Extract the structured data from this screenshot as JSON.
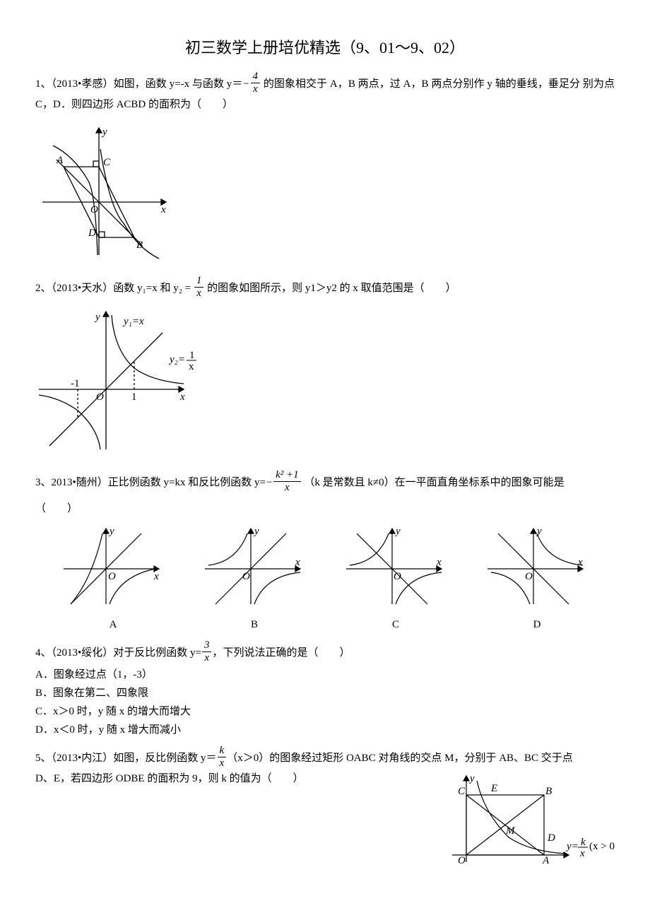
{
  "title": "初三数学上册培优精选（9、01～9、02）",
  "q1": {
    "pre": "1、（2013•孝感）如图，函数 y=-x 与函数 y＝",
    "frac_num": "4",
    "frac_den": "x",
    "neg": "−",
    "post1": " 的图象相交于 A，B 两点，过 A，B 两点分别作 y 轴的垂线，垂足分",
    "post2": "别为点 C，D．则四边形 ACBD 的面积为（　　）"
  },
  "q2": {
    "pre": "2、（2013•天水）函数 y₁=x 和 y₂ = ",
    "frac_num": "1",
    "frac_den": "x",
    "post": " 的图象如图所示，则 y1＞y2 的 x 取值范围是（　　）",
    "fig_label_y1": "y₁=x",
    "fig_label_y2": "y₂= 1/x",
    "neg1": "-1",
    "one": "1"
  },
  "q3": {
    "pre": "3、2013•随州）正比例函数 y=kx 和反比例函数 y=",
    "neg": "−",
    "frac_num": "k² +1",
    "frac_den": "x",
    "post1": " （k 是常数且 k≠0）在一平面直角坐标系中的图象可能是",
    "post2": "（　　）",
    "optA": "A",
    "optB": "B",
    "optC": "C",
    "optD": "D"
  },
  "q4": {
    "pre": "4、（2013•绥化）对于反比例函数 y=",
    "frac_num": "3",
    "frac_den": "x",
    "post": "，下列说法正确的是（　　）",
    "A": "A．图象经过点（1，-3）",
    "B": "B．图象在第二、四象限",
    "C": "C．x＞0 时，y 随 x 的增大而增大",
    "D": "D．x＜0 时，y 随 x 增大而减小"
  },
  "q5": {
    "pre": "5、（2013•内江）如图，反比例函数 y＝",
    "frac_num": "k",
    "frac_den": "x",
    "post1": "（x＞0）的图象经过矩形 OABC 对角线的交点 M，分别于 AB、BC 交于点",
    "post2": "D、E，若四边形 ODBE 的面积为 9，则 k 的值为（　　）",
    "fig_label_yk": "y=",
    "fig_label_cond": "(x > 0)",
    "fig_frac_num": "k",
    "fig_frac_den": "x",
    "lbl_C": "C",
    "lbl_E": "E",
    "lbl_B": "B",
    "lbl_M": "M",
    "lbl_D": "D",
    "lbl_O": "O",
    "lbl_A": "A"
  },
  "axis": {
    "x": "x",
    "y": "y",
    "O": "O"
  }
}
